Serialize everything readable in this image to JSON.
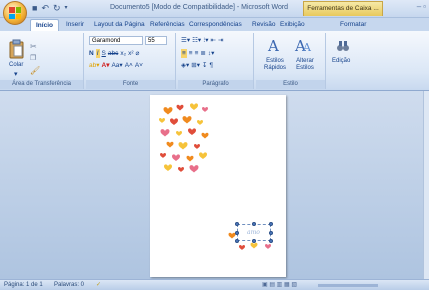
{
  "titlebar": {
    "title": "Documento5 [Modo de Compatibilidade] - Microsoft Word",
    "contextual_tab": "Ferramentas de Caixa ..."
  },
  "tabs": [
    "Início",
    "Inserir",
    "Layout da Página",
    "Referências",
    "Correspondências",
    "Revisão",
    "Exibição",
    "Formatar"
  ],
  "ribbon": {
    "clipboard": {
      "paste": "Colar",
      "label": "Área de Transferência"
    },
    "font": {
      "name": "Garamond",
      "size": "55",
      "label": "Fonte"
    },
    "paragraph": {
      "label": "Parágrafo"
    },
    "styles": {
      "quick": "Estilos Rápidos",
      "change": "Alterar Estilos",
      "label": "Estilo"
    },
    "editing": {
      "label": "Edição"
    }
  },
  "document": {
    "textbox_word": "amo"
  },
  "status": {
    "page": "Página: 1 de 1",
    "words": "Palavras: 0"
  },
  "colors": {
    "heart_orange": "#f08a1e",
    "heart_red": "#e04d3a",
    "heart_yellow": "#f6c33a",
    "heart_pink": "#e86f8a"
  }
}
